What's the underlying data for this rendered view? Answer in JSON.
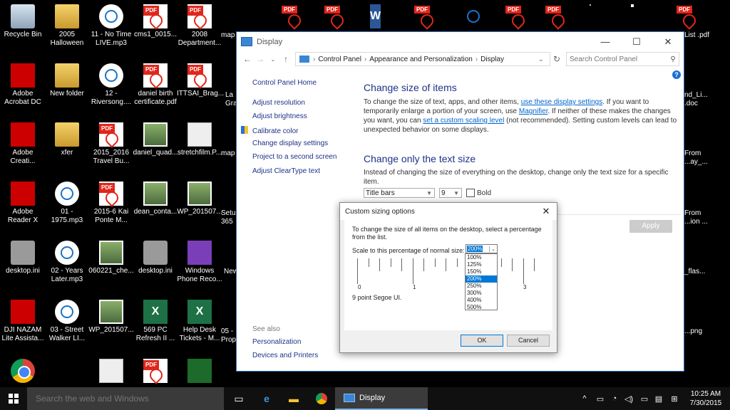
{
  "desktop": {
    "icons": [
      {
        "label": "Recycle Bin",
        "icon": "recycle-bin-icon"
      },
      {
        "label": "2005 Halloween",
        "icon": "folder-icon"
      },
      {
        "label": "11 - No Time LIVE.mp3",
        "icon": "audio-file-icon"
      },
      {
        "label": "cms1_0015...",
        "icon": "pdf-file-icon"
      },
      {
        "label": "2008 Department...",
        "icon": "pdf-file-icon"
      },
      {
        "label": "Adobe Acrobat DC",
        "icon": "acrobat-icon"
      },
      {
        "label": "New folder",
        "icon": "folder-icon"
      },
      {
        "label": "12 - Riversong....",
        "icon": "audio-file-icon"
      },
      {
        "label": "daniel birth certificate.pdf",
        "icon": "pdf-file-icon"
      },
      {
        "label": "ITTSAI_Brag...",
        "icon": "pdf-file-icon"
      },
      {
        "label": "Adobe Creati...",
        "icon": "creative-cloud-icon"
      },
      {
        "label": "xfer",
        "icon": "folder-icon"
      },
      {
        "label": "2015_2016 Travel Bu...",
        "icon": "pdf-file-icon"
      },
      {
        "label": "daniel_quad...",
        "icon": "video-file-icon"
      },
      {
        "label": "stretchfilm.P...",
        "icon": "document-icon"
      },
      {
        "label": "Adobe Reader X",
        "icon": "adobe-reader-icon"
      },
      {
        "label": "01 - 1975.mp3",
        "icon": "audio-file-icon"
      },
      {
        "label": "2015-6 Kai Ponte M...",
        "icon": "pdf-file-icon"
      },
      {
        "label": "dean_conta...",
        "icon": "image-file-icon"
      },
      {
        "label": "WP_201507...",
        "icon": "image-file-icon"
      },
      {
        "label": "desktop.ini",
        "icon": "settings-file-icon"
      },
      {
        "label": "02 - Years Later.mp3",
        "icon": "audio-file-icon"
      },
      {
        "label": "060221_che...",
        "icon": "image-file-icon"
      },
      {
        "label": "desktop.ini",
        "icon": "settings-file-icon"
      },
      {
        "label": "Windows Phone Reco...",
        "icon": "windows-phone-icon"
      },
      {
        "label": "DJI NAZAM Lite Assista...",
        "icon": "dji-icon"
      },
      {
        "label": "03 - Street Walker LI...",
        "icon": "audio-file-icon"
      },
      {
        "label": "WP_201507...",
        "icon": "image-file-icon"
      },
      {
        "label": "569 PC Refresh II ...",
        "icon": "excel-file-icon"
      },
      {
        "label": "Help Desk Tickets - M...",
        "icon": "excel-file-icon"
      },
      {
        "label": "",
        "icon": "chrome-icon"
      },
      {
        "label": "",
        "icon": "document-icon"
      },
      {
        "label": "",
        "icon": "pdf-file-icon"
      },
      {
        "label": "",
        "icon": "green-app-icon"
      }
    ],
    "partial_labels": [
      "map",
      "map",
      "La Gra",
      "Setu 365",
      "New",
      "05 - Prop"
    ],
    "right_labels": [
      "List .pdf",
      "nd_Li... .doc",
      "From ...ay_...",
      "From ...ion ...",
      "_flas...",
      "...png"
    ]
  },
  "window": {
    "title": "Display",
    "controls": {
      "minimize": "—",
      "maximize": "☐",
      "close": "✕"
    },
    "breadcrumb": [
      "Control Panel",
      "Appearance and Personalization",
      "Display"
    ],
    "search_placeholder": "Search Control Panel",
    "left_nav": {
      "home": "Control Panel Home",
      "items": [
        "Adjust resolution",
        "Adjust brightness",
        "Calibrate color",
        "Change display settings",
        "Project to a second screen",
        "Adjust ClearType text"
      ],
      "see_also_title": "See also",
      "see_also": [
        "Personalization",
        "Devices and Printers"
      ]
    },
    "main": {
      "heading1": "Change size of items",
      "para1_a": "To change the size of text, apps, and other items, ",
      "para1_link1": "use these display settings",
      "para1_b": ".  If you want to temporarily enlarge a portion of your screen, use ",
      "para1_link2": "Magnifier",
      "para1_c": ".  If neither of these makes the changes you want, you can ",
      "para1_link3": "set a custom scaling level",
      "para1_d": " (not recommended).  Setting custom levels can lead to unexpected behavior on some displays.",
      "heading2": "Change only the text size",
      "para2": "Instead of changing the size of everything on the desktop, change only the text size for a specific item.",
      "item_select": "Title bars",
      "size_select": "9",
      "bold_label": "Bold",
      "apply_label": "Apply"
    }
  },
  "dialog": {
    "title": "Custom sizing options",
    "description": "To change the size of all items on the desktop, select a percentage from the list.",
    "scale_label": "Scale to this percentage of normal size:",
    "selected": "200%",
    "options": [
      "100%",
      "125%",
      "150%",
      "200%",
      "250%",
      "300%",
      "400%",
      "500%"
    ],
    "ruler_numbers": [
      "0",
      "1",
      "3"
    ],
    "sample_text": "9 point Segoe UI.",
    "ok_label": "OK",
    "cancel_label": "Cancel"
  },
  "taskbar": {
    "search_placeholder": "Search the web and Windows",
    "active_app": "Display",
    "time": "10:25 AM",
    "date": "7/30/2015"
  },
  "colors": {
    "link": "#0066cc",
    "heading": "#1e3287",
    "selection": "#0078d7",
    "window_border": "#2b73c3"
  }
}
